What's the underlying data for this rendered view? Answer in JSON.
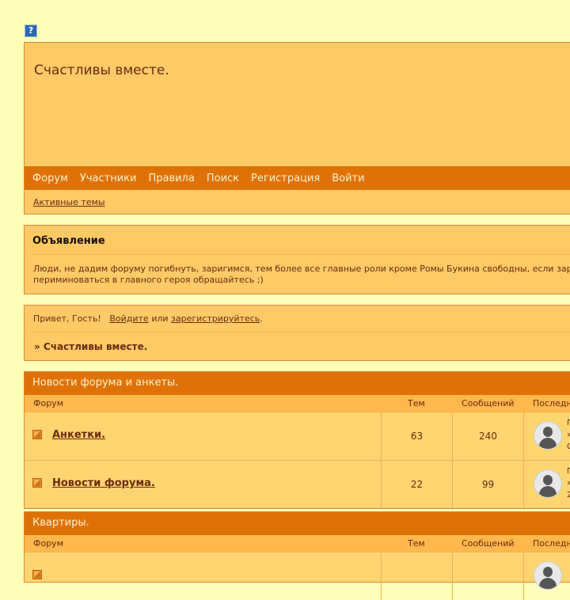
{
  "help_icon": "?",
  "header": {
    "title": "Счастливы вместе.",
    "nav": [
      "Форум",
      "Участники",
      "Правила",
      "Поиск",
      "Регистрация",
      "Войти"
    ],
    "subnav": "Активные темы"
  },
  "announcement": {
    "heading": "Объявление",
    "line1": "Люди, не дадим форуму погибнуть, заригимся, тем более все главные роли кроме Ромы Букина свободны, если зар",
    "line2": "периминоваться в главного героя обращайтесь ;)"
  },
  "guest": {
    "greeting": "Привет, Гость!",
    "login": "Войдите",
    "or": "или",
    "register": "зарегистрируйтесь",
    "dot": ".",
    "crumb": "» Счастливы вместе."
  },
  "categories": [
    {
      "title": "Новости форума и анкеты.",
      "cols": {
        "forum": "Форум",
        "topics": "Тем",
        "posts": "Сообщений",
        "last": "Последн"
      },
      "rows": [
        {
          "name": "Анкетки.",
          "topics": "63",
          "posts": "240",
          "last": [
            "Г",
            "»",
            "С"
          ]
        },
        {
          "name": "Новости форума.",
          "topics": "22",
          "posts": "99",
          "last": [
            "Г",
            "»",
            "2"
          ]
        }
      ]
    },
    {
      "title": "Квартиры.",
      "cols": {
        "forum": "Форум",
        "topics": "Тем",
        "posts": "Сообщений",
        "last": "Последн"
      },
      "rows": []
    }
  ]
}
